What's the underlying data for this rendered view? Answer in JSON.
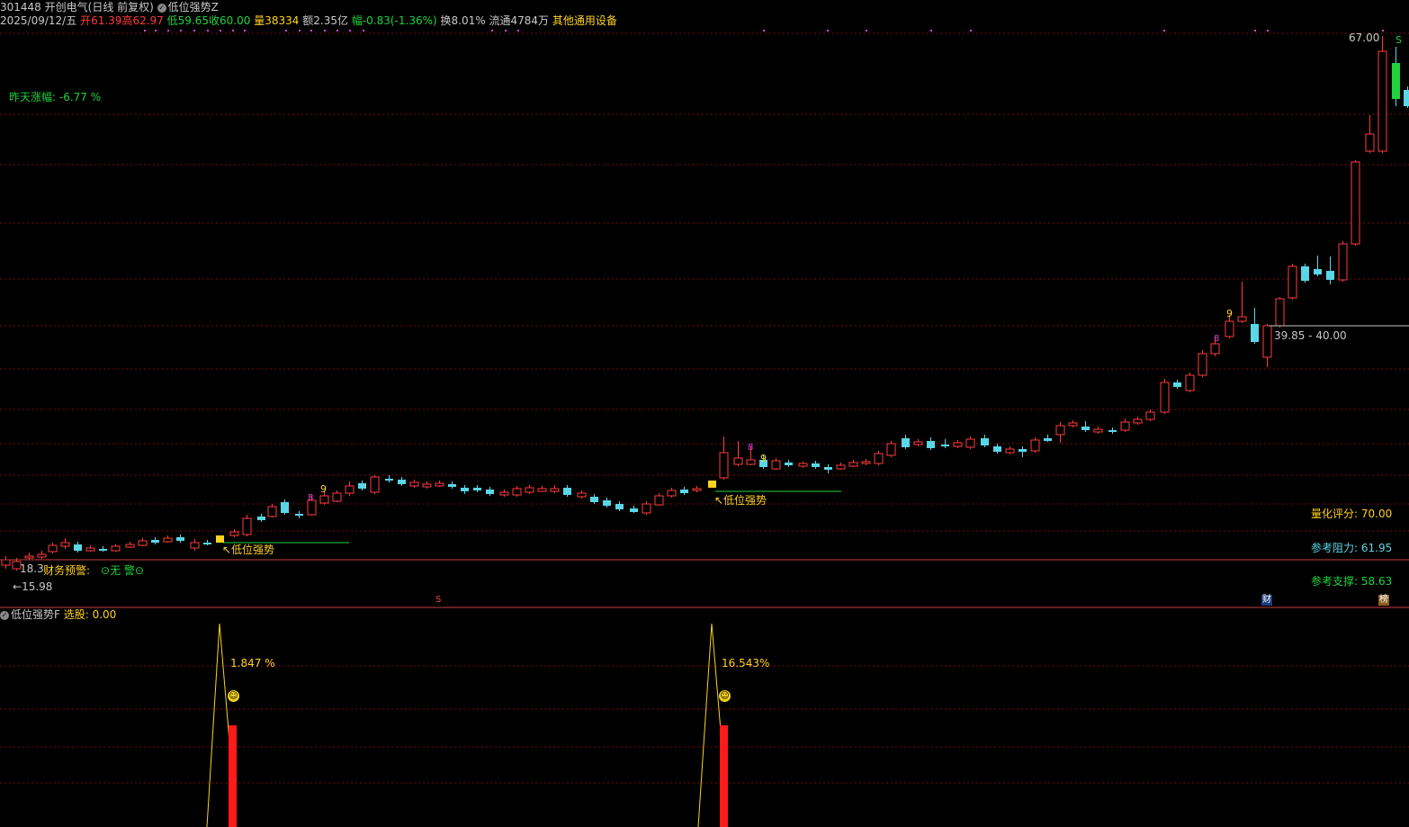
{
  "header": {
    "code": "301448",
    "name": "开创电气",
    "mode": "(日线 前复权)",
    "indicator": "低位强势Z",
    "date": "2025/09/12/五",
    "open_label": "开",
    "open": "61.39",
    "high_label": "高",
    "high": "62.97",
    "low_label": "低",
    "low": "59.65",
    "close_label": "收",
    "close": "60.00",
    "volume_label": "量",
    "volume": "38334",
    "amount_label": "额",
    "amount": "2.35亿",
    "change_label": "幅",
    "change": "-0.83(-1.36%)",
    "turnover_label": "换",
    "turnover": "8.01%",
    "float_label": "流通",
    "float": "4784万",
    "sector": "其他通用设备"
  },
  "main": {
    "yesterday_change": "昨天涨幅: -6.77 %",
    "max_price": "67.00",
    "max_marker": "S",
    "range_label": "39.85 - 40.00",
    "min_price_left": "18.3",
    "min_price": "15.98",
    "finance_warning": "财务预警:",
    "warning_value": "无  警",
    "signal_label_1": "↖低位强势",
    "signal_label_2": "↖低位强势",
    "count_9_a": "9",
    "count_8_a": "8",
    "count_8_b": "8",
    "count_9_b": "9",
    "count_8_c": "8",
    "count_9_c": "9",
    "quant_score": "量化评分: 70.00",
    "ref_resistance": "参考阻力: 61.95",
    "ref_support": "参考支撑: 58.63",
    "event_s": "S",
    "event_cai": "财",
    "event_bang": "榜"
  },
  "sub": {
    "indicator": "低位强势F",
    "select_label": "选股: 0.00",
    "pct_1": "1.847",
    "pct_2": "16.543",
    "pct_unit": "%"
  },
  "colors": {
    "up": "#ff3b3b",
    "down": "#5ad6e6",
    "grid": "#8b0000",
    "signal_line": "#1fd33c",
    "yellow": "#ffd21e"
  }
}
